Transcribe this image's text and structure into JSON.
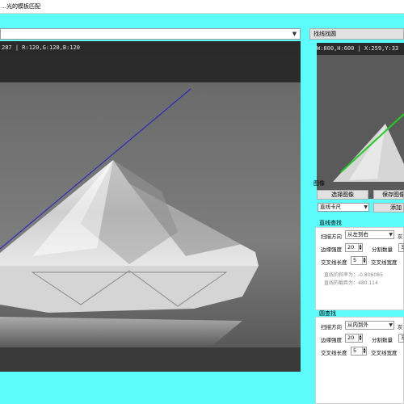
{
  "window": {
    "title": "…光的模板匹配"
  },
  "main": {
    "source_combo_value": "",
    "info_bar": "287 | R:120,G:120,B:120"
  },
  "right": {
    "thumb_button": "找线找圆",
    "thumb_info": "W:800,H:600 | X:259,Y:33",
    "image_section": {
      "label": "图像",
      "select_image_button": "选择图像",
      "save_image_button": "保存图像",
      "tool_combo_value": "直线卡尺",
      "add_button": "添加"
    },
    "line_group": {
      "title": "直线查找",
      "scan_direction_label": "扫描方向",
      "scan_direction_value": "从左到右",
      "trailing_label_1": "灰",
      "edge_strength_label": "边缘强度",
      "edge_strength_value": "20",
      "sub_count_label": "分割数量",
      "sub_count_value": "30",
      "cross_length_label": "交叉线长度",
      "cross_length_value": "5",
      "cross_width_label": "交叉线宽度",
      "result_slope": "直线的斜率为：-0.806085",
      "result_intercept": "直线的截距为：480.114"
    },
    "circle_group": {
      "title": "圆查找",
      "scan_direction_label": "扫描方向",
      "scan_direction_value": "从内到外",
      "trailing_label_1": "灰",
      "edge_strength_label": "边缘强度",
      "edge_strength_value": "20",
      "sub_count_label": "分割数量",
      "sub_count_value": "30",
      "cross_length_label": "交叉线长度",
      "cross_length_value": "5",
      "cross_width_label": "交叉线宽度"
    }
  },
  "colors": {
    "window_bg": "#5dfcfb",
    "detected_line": "#2020c8",
    "thumb_line": "#22cc22"
  },
  "icons": {
    "combo_arrow": "chevron-down-icon",
    "spin": "spin-updown-icon"
  }
}
